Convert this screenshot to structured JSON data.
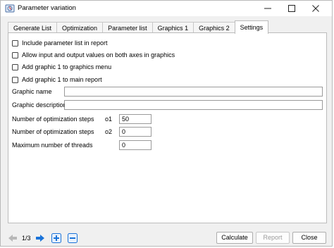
{
  "window": {
    "title": "Parameter variation"
  },
  "tabs": [
    "Generate List",
    "Optimization",
    "Parameter list",
    "Graphics 1",
    "Graphics 2",
    "Settings"
  ],
  "active_tab": "Settings",
  "checkboxes": [
    {
      "label": "Include parameter list in report",
      "checked": false
    },
    {
      "label": "Allow input and output values on both axes in graphics",
      "checked": false
    },
    {
      "label": "Add graphic 1 to graphics menu",
      "checked": false
    },
    {
      "label": "Add graphic 1 to main report",
      "checked": false
    }
  ],
  "fields": {
    "graphic_name": {
      "label": "Graphic name",
      "value": ""
    },
    "graphic_description": {
      "label": "Graphic description",
      "value": ""
    },
    "steps_o1": {
      "label": "Number of optimization steps",
      "code": "o1",
      "value": "50"
    },
    "steps_o2": {
      "label": "Number of optimization steps",
      "code": "o2",
      "value": "0"
    },
    "threads": {
      "label": "Maximum number of threads",
      "value": "0"
    }
  },
  "footer": {
    "counter": "1/3",
    "calculate": "Calculate",
    "report": "Report",
    "close": "Close"
  },
  "icons": [
    "app-icon",
    "minimize-icon",
    "maximize-icon",
    "close-icon",
    "prev-arrow-icon",
    "next-arrow-icon",
    "add-icon",
    "remove-icon"
  ],
  "colors": {
    "accent": "#1a73d9",
    "disabled_text": "#9a9a9a"
  }
}
